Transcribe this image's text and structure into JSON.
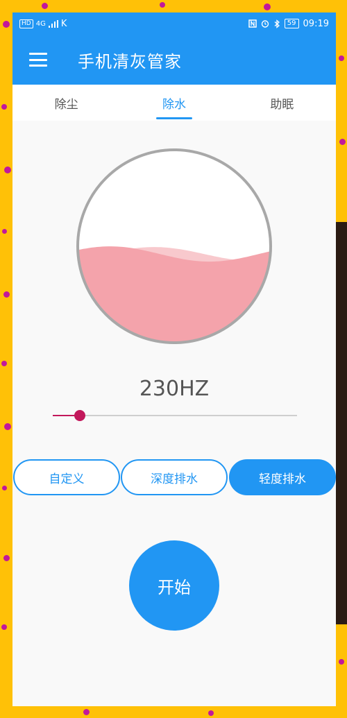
{
  "status_bar": {
    "hd_badge": "HD",
    "network": "4G",
    "carrier_icon": "K",
    "battery": "59",
    "time": "09:19",
    "icons": [
      "nfc-icon",
      "alarm-icon",
      "bluetooth-icon",
      "battery-icon"
    ]
  },
  "app_bar": {
    "title": "手机清灰管家",
    "menu_icon": "hamburger-menu-icon"
  },
  "tabs": [
    {
      "label": "除尘",
      "active": false
    },
    {
      "label": "除水",
      "active": true
    },
    {
      "label": "助眠",
      "active": false
    }
  ],
  "gauge": {
    "fill_level": 0.46,
    "wave_color": "#f4a3ab",
    "wave_back_color": "#f8c9cd",
    "ring_color": "#a8a8a8"
  },
  "frequency": {
    "display": "230HZ",
    "slider_fraction": 0.11,
    "accent": "#c2185b"
  },
  "modes": [
    {
      "label": "自定义",
      "selected": false
    },
    {
      "label": "深度排水",
      "selected": false
    },
    {
      "label": "轻度排水",
      "selected": true
    }
  ],
  "start_button": {
    "label": "开始"
  },
  "colors": {
    "primary": "#2196f3",
    "background": "#f9f9f9",
    "frame": "#ffc107"
  }
}
